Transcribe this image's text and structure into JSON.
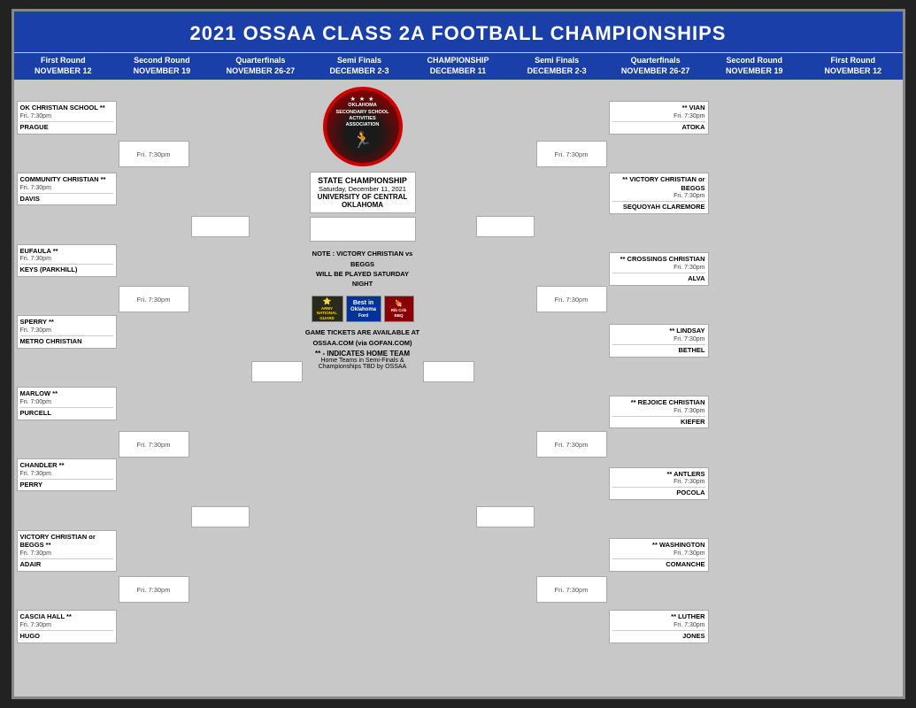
{
  "title": "2021 OSSAA CLASS 2A FOOTBALL CHAMPIONSHIPS",
  "rounds": {
    "left": [
      {
        "label": "First Round",
        "date": "NOVEMBER 12"
      },
      {
        "label": "Second Round",
        "date": "NOVEMBER 19"
      },
      {
        "label": "Quarterfinals",
        "date": "NOVEMBER 26-27"
      },
      {
        "label": "Semi Finals",
        "date": "DECEMBER 2-3"
      }
    ],
    "center": {
      "label": "CHAMPIONSHIP",
      "date": "DECEMBER 11"
    },
    "right": [
      {
        "label": "Semi Finals",
        "date": "DECEMBER 2-3"
      },
      {
        "label": "Quarterfinals",
        "date": "NOVEMBER 26-27"
      },
      {
        "label": "Second Round",
        "date": "NOVEMBER 19"
      },
      {
        "label": "First Round",
        "date": "NOVEMBER 12"
      }
    ]
  },
  "championship": {
    "label": "STATE CHAMPIONSHIP",
    "date": "Saturday, December 11, 2021",
    "venue": "UNIVERSITY OF CENTRAL OKLAHOMA"
  },
  "left_r1": [
    {
      "time": "Fri. 7:30pm",
      "team1": "OK CHRISTIAN SCHOOL **",
      "team2": "PRAGUE"
    },
    {
      "time": "Fri. 7:30pm",
      "team1": "COMMUNITY CHRISTIAN **",
      "team2": "DAVIS"
    },
    {
      "time": "Fri. 7:30pm",
      "team1": "EUFAULA **",
      "team2": "KEYS (PARKHILL)"
    },
    {
      "time": "Fri. 7:30pm",
      "team1": "SPERRY **",
      "team2": "METRO CHRISTIAN"
    },
    {
      "time": "Fri. 7:00pm",
      "team1": "MARLOW **",
      "team2": "PURCELL"
    },
    {
      "time": "Fri. 7:30pm",
      "team1": "CHANDLER **",
      "team2": "PERRY"
    },
    {
      "time": "Fri. 7:30pm",
      "team1": "VICTORY CHRISTIAN or BEGGS **",
      "team2": "ADAIR"
    },
    {
      "time": "Fri. 7:30pm",
      "team1": "CASCIA HALL **",
      "team2": "HUGO"
    }
  ],
  "left_r2": [
    {
      "time": "Fri. 7:30pm"
    },
    {
      "time": "Fri. 7:30pm"
    },
    {
      "time": "Fri. 7:30pm"
    },
    {
      "time": "Fri. 7:30pm"
    }
  ],
  "left_r3": [
    {
      "time": ""
    },
    {
      "time": ""
    }
  ],
  "left_sf": [
    {
      "time": ""
    }
  ],
  "right_r1": [
    {
      "time": "Fri. 7:30pm",
      "team1": "** VIAN",
      "team2": "ATOKA"
    },
    {
      "time": "Fri. 7:30pm",
      "team1": "** VICTORY CHRISTIAN or BEGGS",
      "team2": "SEQUOYAH CLAREMORE"
    },
    {
      "time": "Fri. 7:30pm",
      "team1": "** CROSSINGS CHRISTIAN",
      "team2": "ALVA"
    },
    {
      "time": "Fri. 7:30pm",
      "team1": "** LINDSAY",
      "team2": "BETHEL"
    },
    {
      "time": "Fri. 7:30pm",
      "team1": "** REJOICE CHRISTIAN",
      "team2": "KIEFER"
    },
    {
      "time": "Fri. 7:30pm",
      "team1": "** ANTLERS",
      "team2": "POCOLA"
    },
    {
      "time": "Fri. 7:30pm",
      "team1": "** WASHINGTON",
      "team2": "COMANCHE"
    },
    {
      "time": "Fri. 7:30pm",
      "team1": "** LUTHER",
      "team2": "JONES"
    }
  ],
  "right_r2": [
    {
      "time": "Fri. 7:30pm"
    },
    {
      "time": "Fri. 7:30pm"
    },
    {
      "time": "Fri. 7:30pm"
    },
    {
      "time": "Fri. 7:30pm"
    }
  ],
  "right_r3": [
    {
      "time": ""
    },
    {
      "time": ""
    }
  ],
  "right_sf": [
    {
      "time": ""
    }
  ],
  "note": {
    "line1": "NOTE : VICTORY CHRISTIAN vs BEGGS",
    "line2": "WILL BE PLAYED SATURDAY NIGHT"
  },
  "footer": {
    "tickets": "GAME TICKETS ARE AVAILABLE AT OSSAA.COM (via GOFAN.COM)",
    "home_team": "** - INDICATES HOME TEAM",
    "home_note": "Home Teams in Semi-Finals & Championships TBD by OSSAA"
  },
  "sponsors": [
    {
      "name": "Oklahoma Army National Guard",
      "short": "ARMY NATIONAL GUARD"
    },
    {
      "name": "Best in Oklahoma Ford",
      "short": "Best in Oklahoma"
    },
    {
      "name": "Buffalo Rib Crib",
      "short": "Rib Crib"
    }
  ]
}
